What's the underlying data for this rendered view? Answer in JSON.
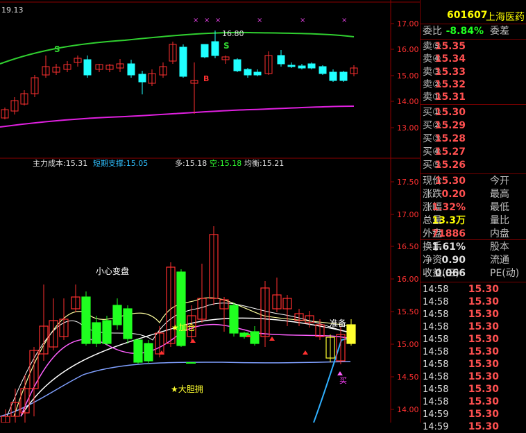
{
  "top_panel": {
    "hi_value": "19.13",
    "peak_label": "16.80",
    "signal_s1": "S",
    "signal_s2": "S",
    "signal_b": "B",
    "y_ticks": [
      "17.00",
      "16.00",
      "15.00",
      "14.00",
      "13.00"
    ]
  },
  "indicator_header": {
    "main_cost": "主力成本:15.31",
    "short_support": "短期支撑:15.05",
    "long": "多:15.18",
    "short": "空:15.18",
    "balance": "均衡:15.21"
  },
  "bottom_panel": {
    "y_ticks": [
      "17.50",
      "17.00",
      "16.50",
      "16.00",
      "15.50",
      "15.00",
      "14.50",
      "14.00"
    ],
    "note_careful": "小心变盘",
    "note_add": "★加仓",
    "note_bold_hold": "★大胆拥",
    "note_prepare": "准备",
    "note_buy": "买"
  },
  "quote": {
    "code": "601607",
    "name": "上海医药",
    "ratio_label": "委比",
    "ratio_value": "-8.84%",
    "diff_label": "委差",
    "asks": [
      {
        "label": "卖⑤",
        "price": "15.35"
      },
      {
        "label": "卖④",
        "price": "15.34"
      },
      {
        "label": "卖③",
        "price": "15.33"
      },
      {
        "label": "卖②",
        "price": "15.32"
      },
      {
        "label": "卖①",
        "price": "15.31"
      }
    ],
    "bids": [
      {
        "label": "买①",
        "price": "15.30"
      },
      {
        "label": "买②",
        "price": "15.29"
      },
      {
        "label": "买③",
        "price": "15.28"
      },
      {
        "label": "买④",
        "price": "15.27"
      },
      {
        "label": "买⑤",
        "price": "15.26"
      }
    ],
    "stats": [
      {
        "label": "现价",
        "value": "15.30",
        "color": "red",
        "label2": "今开"
      },
      {
        "label": "涨跌",
        "value": "0.20",
        "color": "red",
        "label2": "最高"
      },
      {
        "label": "涨幅",
        "value": "1.32%",
        "color": "red",
        "label2": "最低"
      },
      {
        "label": "总量",
        "value": "13.3万",
        "color": "yellow",
        "label2": "量比"
      },
      {
        "label": "外盘",
        "value": "71886",
        "color": "red",
        "label2": "内盘"
      }
    ],
    "stats2": [
      {
        "label": "换手",
        "value": "1.61%",
        "color": "white",
        "label2": "股本"
      },
      {
        "label": "净资",
        "value": "0.90",
        "color": "white",
        "label2": "流通"
      },
      {
        "label": "收益(三)",
        "value": "0.066",
        "color": "white",
        "label2": "PE(动)"
      }
    ],
    "ticks": [
      {
        "time": "14:58",
        "price": "15.30"
      },
      {
        "time": "14:58",
        "price": "15.30"
      },
      {
        "time": "14:58",
        "price": "15.30"
      },
      {
        "time": "14:58",
        "price": "15.30"
      },
      {
        "time": "14:58",
        "price": "15.30"
      },
      {
        "time": "14:58",
        "price": "15.30"
      },
      {
        "time": "14:58",
        "price": "15.30"
      },
      {
        "time": "14:58",
        "price": "15.30"
      },
      {
        "time": "14:58",
        "price": "15.30"
      },
      {
        "time": "14:58",
        "price": "15.30"
      },
      {
        "time": "14:59",
        "price": "15.30"
      },
      {
        "time": "14:59",
        "price": "15.30"
      }
    ]
  },
  "colors": {
    "up": "#ff3030",
    "down": "#20ffff",
    "ma_green": "#30d030",
    "ma_magenta": "#e020e0",
    "bright_green": "#20ff20",
    "yellow": "#ffff30"
  }
}
